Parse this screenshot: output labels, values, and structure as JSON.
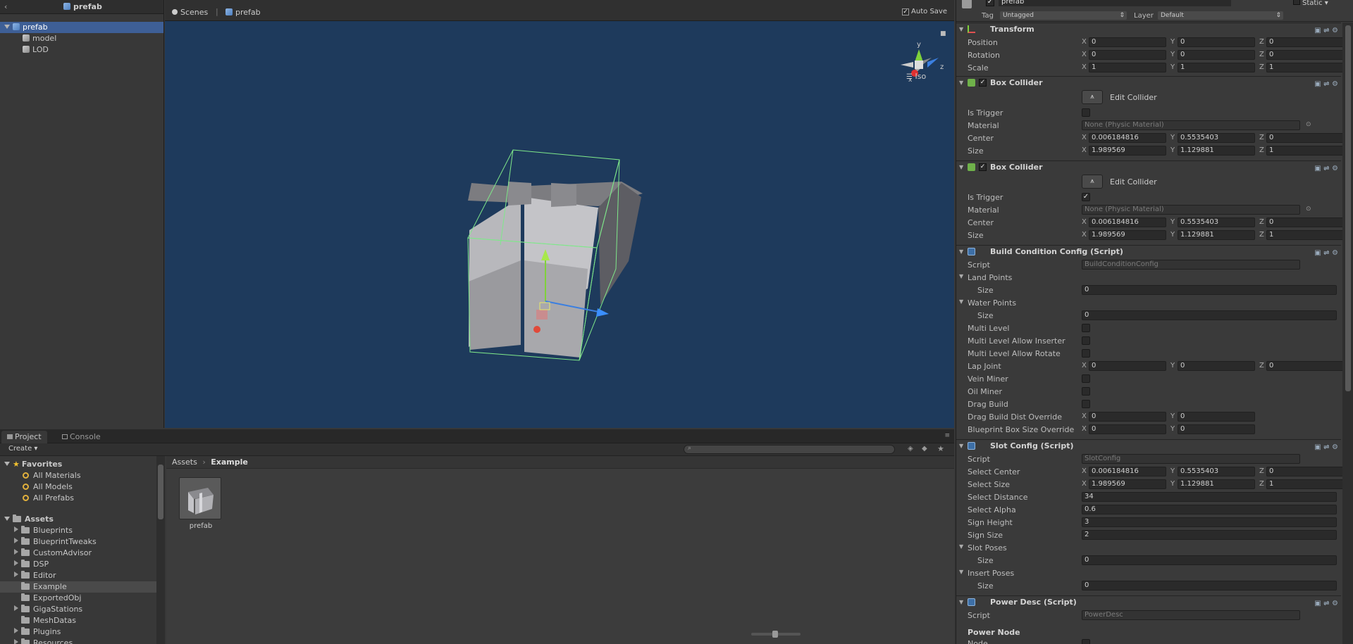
{
  "hierarchy": {
    "breadcrumb": "prefab",
    "items": [
      {
        "label": "prefab",
        "selected": true
      },
      {
        "label": "model"
      },
      {
        "label": "LOD"
      }
    ]
  },
  "scene": {
    "tab_scenes": "Scenes",
    "tab_prefab": "prefab",
    "auto_save": "Auto Save",
    "gizmo_y": "y",
    "gizmo_z": "z",
    "gizmo_x": "x",
    "iso": "Iso",
    "background": "#1e3a5c"
  },
  "inspector": {
    "object_name": "prefab",
    "static_label": "Static",
    "tag_label": "Tag",
    "tag_value": "Untagged",
    "layer_label": "Layer",
    "layer_value": "Default",
    "transform": {
      "title": "Transform",
      "position_label": "Position",
      "position": [
        "0",
        "0",
        "0"
      ],
      "rotation_label": "Rotation",
      "rotation": [
        "0",
        "0",
        "0"
      ],
      "scale_label": "Scale",
      "scale": [
        "1",
        "1",
        "1"
      ]
    },
    "box_collider_1": {
      "title": "Box Collider",
      "edit_collider": "Edit Collider",
      "is_trigger_label": "Is Trigger",
      "is_trigger": false,
      "material_label": "Material",
      "material": "None (Physic Material)",
      "center_label": "Center",
      "center": [
        "0.006184816",
        "0.5535403",
        "0"
      ],
      "size_label": "Size",
      "size": [
        "1.989569",
        "1.129881",
        "1"
      ]
    },
    "box_collider_2": {
      "title": "Box Collider",
      "edit_collider": "Edit Collider",
      "is_trigger_label": "Is Trigger",
      "is_trigger": true,
      "material_label": "Material",
      "material": "None (Physic Material)",
      "center_label": "Center",
      "center": [
        "0.006184816",
        "0.5535403",
        "0"
      ],
      "size_label": "Size",
      "size": [
        "1.989569",
        "1.129881",
        "1"
      ]
    },
    "build_condition": {
      "title": "Build Condition Config (Script)",
      "script_label": "Script",
      "script": "BuildConditionConfig",
      "land_points": "Land Points",
      "land_size_label": "Size",
      "land_size": "0",
      "water_points": "Water Points",
      "water_size_label": "Size",
      "water_size": "0",
      "multi_level": "Multi Level",
      "multi_level_inserter": "Multi Level Allow Inserter",
      "multi_level_rotate": "Multi Level Allow Rotate",
      "lap_joint": "Lap Joint",
      "lap_joint_xyz": [
        "0",
        "0",
        "0"
      ],
      "vein_miner": "Vein Miner",
      "oil_miner": "Oil Miner",
      "drag_build": "Drag Build",
      "drag_build_dist": "Drag Build Dist Override",
      "drag_build_dist_xy": [
        "0",
        "0"
      ],
      "blueprint_box": "Blueprint Box Size Override",
      "blueprint_box_xy": [
        "0",
        "0"
      ]
    },
    "slot_config": {
      "title": "Slot Config (Script)",
      "script_label": "Script",
      "script": "SlotConfig",
      "select_center_label": "Select Center",
      "select_center": [
        "0.006184816",
        "0.5535403",
        "0"
      ],
      "select_size_label": "Select Size",
      "select_size": [
        "1.989569",
        "1.129881",
        "1"
      ],
      "select_distance_label": "Select Distance",
      "select_distance": "34",
      "select_alpha_label": "Select Alpha",
      "select_alpha": "0.6",
      "sign_height_label": "Sign Height",
      "sign_height": "3",
      "sign_size_label": "Sign Size",
      "sign_size": "2",
      "slot_poses": "Slot Poses",
      "slot_poses_size_label": "Size",
      "slot_poses_size": "0",
      "insert_poses": "Insert Poses",
      "insert_poses_size_label": "Size",
      "insert_poses_size": "0"
    },
    "power_desc": {
      "title": "Power Desc (Script)",
      "script_label": "Script",
      "script": "PowerDesc",
      "power_node": "Power Node",
      "node_label": "Node"
    }
  },
  "project": {
    "tab_project": "Project",
    "tab_console": "Console",
    "create": "Create",
    "favorites": "Favorites",
    "fav_items": [
      "All Materials",
      "All Models",
      "All Prefabs"
    ],
    "assets": "Assets",
    "folders": [
      "Blueprints",
      "BlueprintTweaks",
      "CustomAdvisor",
      "DSP",
      "Editor",
      "Example",
      "ExportedObj",
      "GigaStations",
      "MeshDatas",
      "Plugins",
      "Resources"
    ],
    "breadcrumb_root": "Assets",
    "breadcrumb_current": "Example",
    "asset_name": "prefab"
  }
}
